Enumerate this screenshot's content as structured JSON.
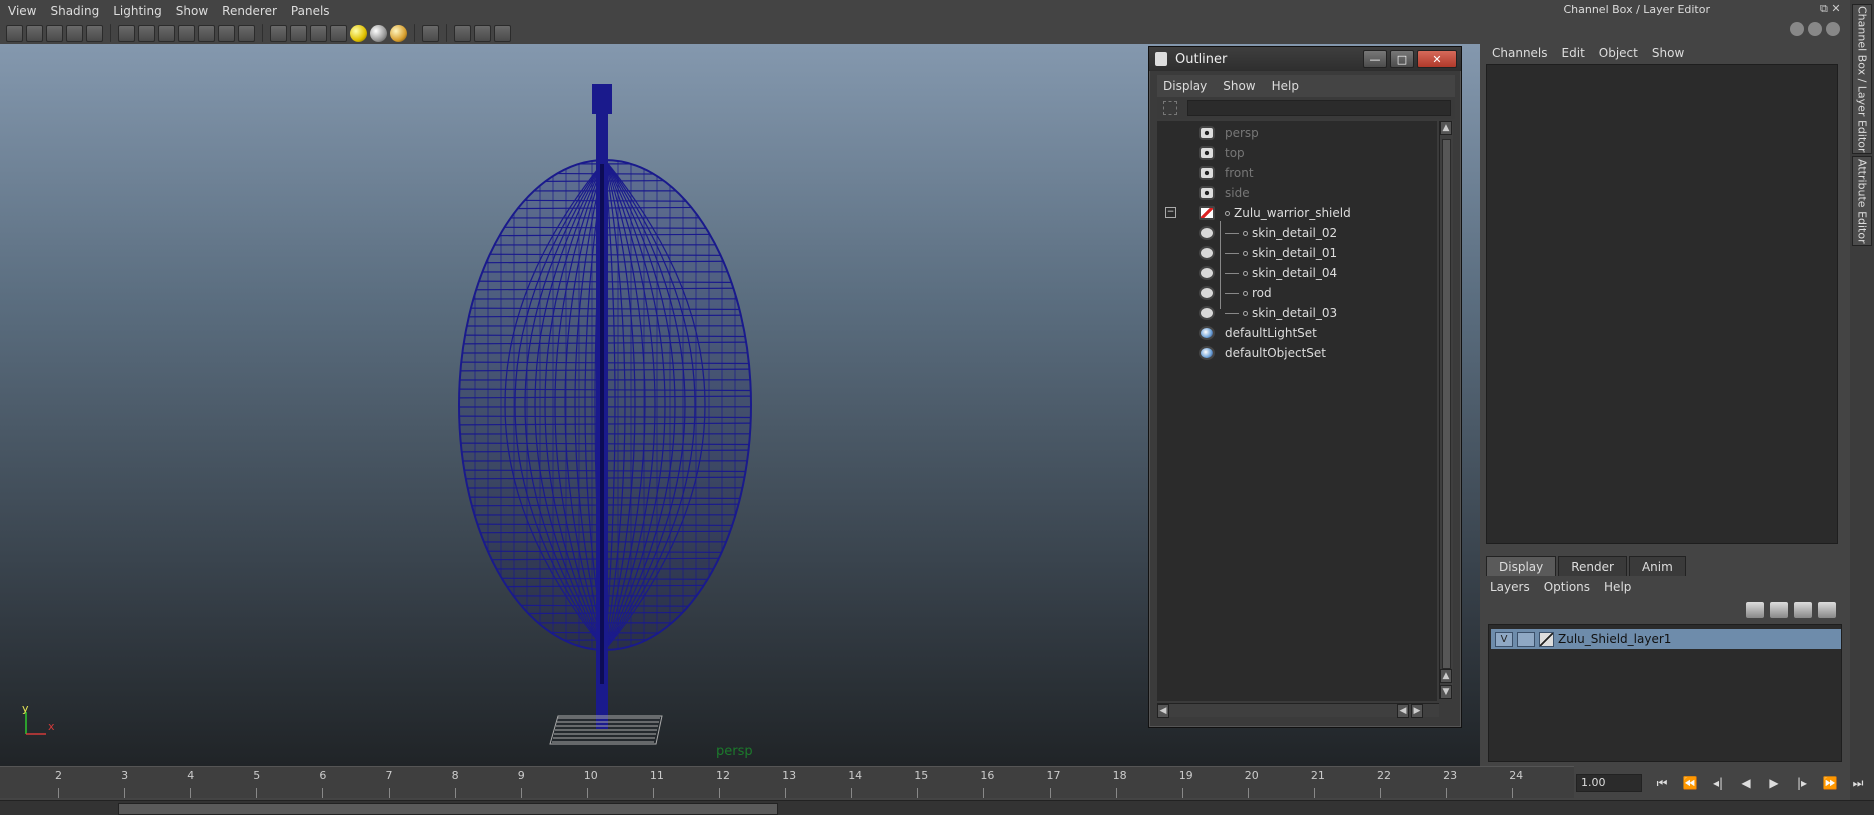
{
  "menubar": [
    "View",
    "Shading",
    "Lighting",
    "Show",
    "Renderer",
    "Panels"
  ],
  "viewport": {
    "camera_label": "persp",
    "axis_y": "y",
    "axis_x": "x"
  },
  "outliner": {
    "title": "Outliner",
    "menu": [
      "Display",
      "Show",
      "Help"
    ],
    "cameras": [
      "persp",
      "top",
      "front",
      "side"
    ],
    "group": "Zulu_warrior_shield",
    "children": [
      "skin_detail_02",
      "skin_detail_01",
      "skin_detail_04",
      "rod",
      "skin_detail_03"
    ],
    "sets": [
      "defaultLightSet",
      "defaultObjectSet"
    ]
  },
  "right_panel": {
    "title": "Channel Box / Layer Editor",
    "menu": [
      "Channels",
      "Edit",
      "Object",
      "Show"
    ],
    "layer_tabs": [
      "Display",
      "Render",
      "Anim"
    ],
    "layer_menu": [
      "Layers",
      "Options",
      "Help"
    ],
    "layer": {
      "visible": "V",
      "name": "Zulu_Shield_layer1"
    },
    "side_tabs": [
      "Channel Box / Layer Editor",
      "Attribute Editor"
    ]
  },
  "timeline": {
    "ticks": [
      "2",
      "3",
      "4",
      "5",
      "6",
      "7",
      "8",
      "9",
      "10",
      "11",
      "12",
      "13",
      "14",
      "15",
      "16",
      "17",
      "18",
      "19",
      "20",
      "21",
      "22",
      "23",
      "24"
    ],
    "current_time": "1.00"
  },
  "colors": {
    "wire": "#1a1a8c",
    "layer_highlight": "#6e8cab",
    "persp_label": "#1c7a2c"
  }
}
